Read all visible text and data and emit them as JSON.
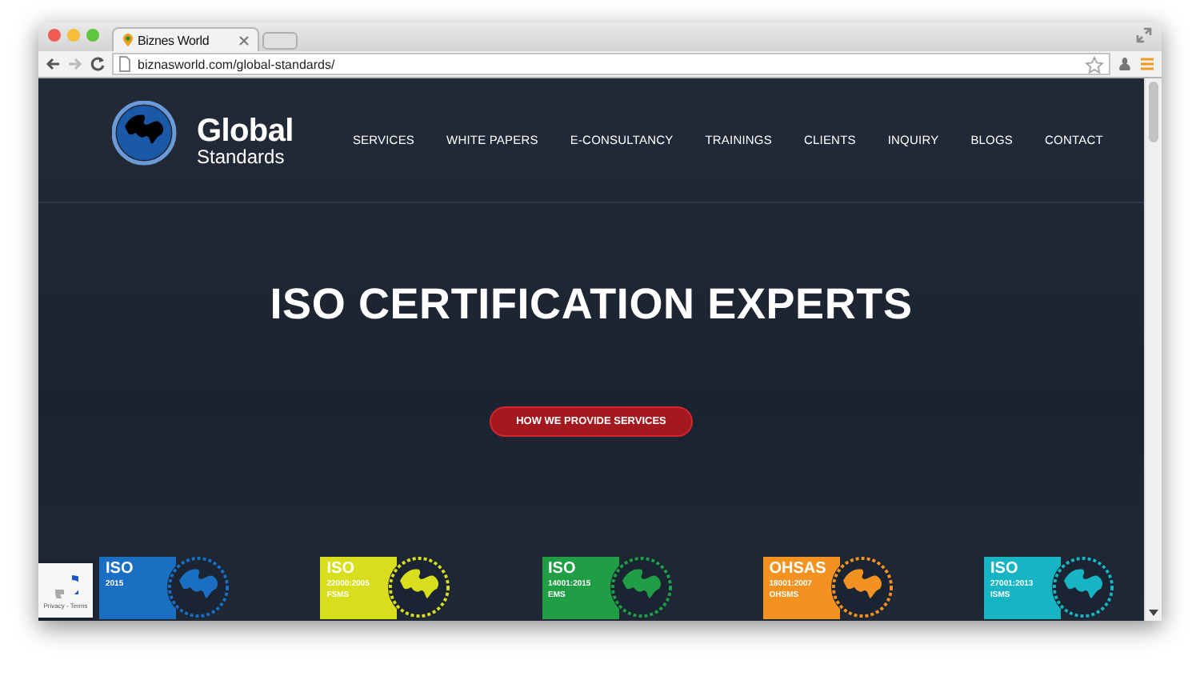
{
  "window": {
    "tab_title": "Biznes World",
    "url": "biznasworld.com/global-standards/"
  },
  "logo": {
    "line_1": "Global",
    "line_2": "Standards"
  },
  "nav": [
    {
      "label": "SERVICES"
    },
    {
      "label": "WHITE PAPERS"
    },
    {
      "label": "E-CONSULTANCY"
    },
    {
      "label": "TRAININGS"
    },
    {
      "label": "CLIENTS"
    },
    {
      "label": "INQUIRY"
    },
    {
      "label": "BLOGS"
    },
    {
      "label": "CONTACT"
    }
  ],
  "hero": {
    "headline": "ISO CERTIFICATION EXPERTS",
    "button": "HOW WE PROVIDE SERVICES"
  },
  "badges": [
    {
      "title": "ISO",
      "code": "2015",
      "color": "#1b6fc2"
    },
    {
      "title": "ISO",
      "code": "22000:2005",
      "scheme": "FSMS",
      "color": "#d9de1c"
    },
    {
      "title": "ISO",
      "code": "14001:2015",
      "scheme": "EMS",
      "color": "#1f9e45"
    },
    {
      "title": "OHSAS",
      "code": "18001:2007",
      "scheme": "OHSMS",
      "color": "#f29321"
    },
    {
      "title": "ISO",
      "code": "27001:2013",
      "scheme": "ISMS",
      "color": "#17b5c4"
    }
  ],
  "recaptcha": {
    "links": "Privacy - Terms"
  }
}
